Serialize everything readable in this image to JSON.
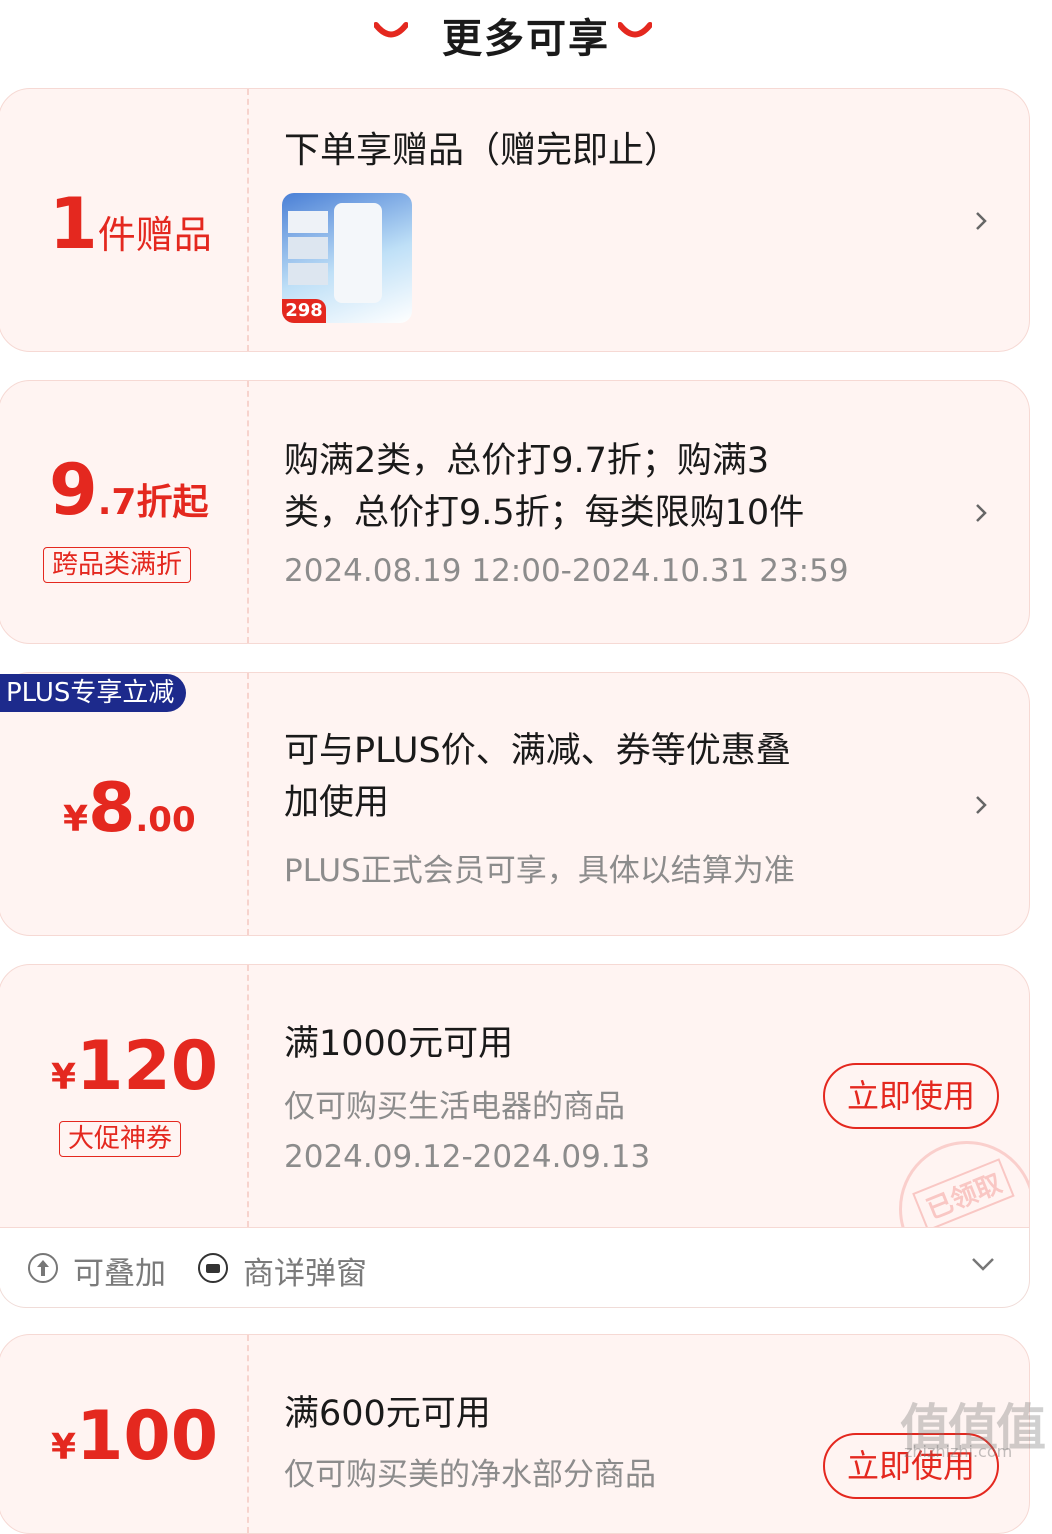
{
  "header": {
    "title": "更多可享"
  },
  "gift_card": {
    "count": "1",
    "unit": "件赠品",
    "title": "下单享赠品（赠完即止）",
    "thumb_price": "298"
  },
  "discount_card": {
    "big": "9",
    "small": ".7折起",
    "tag": "跨品类满折",
    "desc_line1": "购满2类，总价打9.7折；购满3",
    "desc_line2": "类，总价打9.5折；每类限购10件",
    "period": "2024.08.19 12:00-2024.10.31 23:59"
  },
  "plus_card": {
    "badge": "PLUS专享立减",
    "currency": "¥",
    "amount": "8",
    "decimal": ".00",
    "desc_line1": "可与PLUS价、满减、券等优惠叠",
    "desc_line2": "加使用",
    "note": "PLUS正式会员可享，具体以结算为准"
  },
  "coupon_120": {
    "currency": "¥",
    "amount": "120",
    "tag": "大促神券",
    "condition": "满1000元可用",
    "scope": "仅可购买生活电器的商品",
    "period": "2024.09.12-2024.09.13",
    "button": "立即使用",
    "stamp": "已领取",
    "footer_stack": "可叠加",
    "footer_detail": "商详弹窗"
  },
  "coupon_100": {
    "currency": "¥",
    "amount": "100",
    "condition": "满600元可用",
    "scope": "仅可购买美的净水部分商品",
    "button": "立即使用"
  },
  "watermark": {
    "text": "值",
    "site": "zhizhizhi.com"
  },
  "colors": {
    "accent": "#e4281f",
    "card_bg": "#fff4f2",
    "plus_badge": "#1d2a8c"
  }
}
